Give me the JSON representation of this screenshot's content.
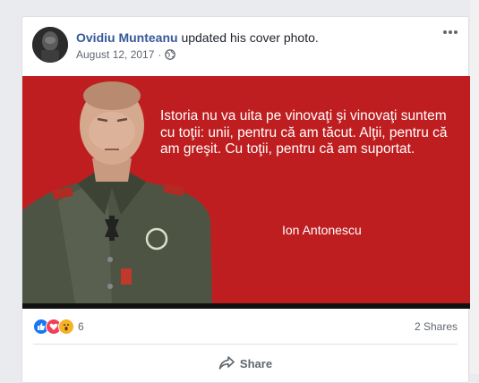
{
  "post": {
    "author": "Ovidiu Munteanu",
    "action": "updated his cover photo.",
    "date": "August 12, 2017",
    "separator": "·",
    "privacy_icon": "globe-icon",
    "more_icon": "more-options-icon"
  },
  "photo": {
    "quote": "Istoria nu va uita pe vinovaţi şi vinovaţi suntem cu toţii: unii, pentru că am tăcut. Alţii, pentru că am greşit. Cu toţii, pentru că am suportat.",
    "quote_author": "Ion Antonescu",
    "background_color": "#bf1e20"
  },
  "stats": {
    "reaction_icons": [
      "like-icon",
      "love-icon",
      "wow-icon"
    ],
    "reaction_count": "6",
    "shares": "2 Shares"
  },
  "actions": {
    "share_label": "Share"
  },
  "colors": {
    "link": "#365899",
    "like": "#1877f2",
    "love": "#f33e58",
    "wow": "#f7b125"
  }
}
